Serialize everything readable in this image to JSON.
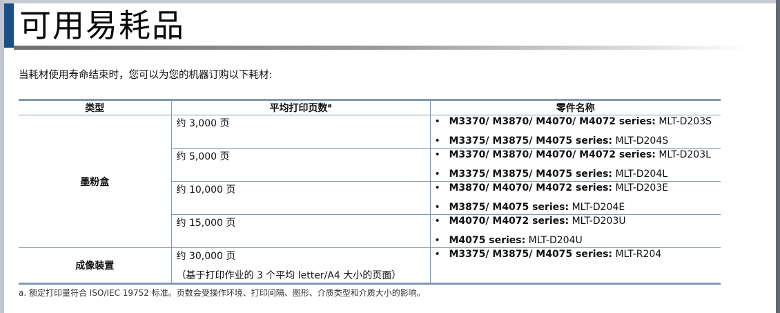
{
  "title": "可用易耗品",
  "intro": "当耗材使用寿命结束时，您可以为您的机器订购以下耗材:",
  "table": {
    "headers": {
      "type": "类型",
      "yield": "平均打印页数",
      "yield_sup": "a",
      "part": "零件名称"
    },
    "toner": {
      "type": "墨粉盒",
      "rows": [
        {
          "yield": "约 3,000 页",
          "parts": [
            {
              "models": "M3370/ M3870/ M4070/ M4072 series:",
              "code": " MLT-D203S"
            },
            {
              "models": "M3375/ M3875/ M4075 series:",
              "code": " MLT-D204S"
            }
          ]
        },
        {
          "yield": "约 5,000 页",
          "parts": [
            {
              "models": "M3370/ M3870/ M4070/ M4072 series:",
              "code": " MLT-D203L"
            },
            {
              "models": "M3375/ M3875/ M4075 series:",
              "code": " MLT-D204L"
            }
          ]
        },
        {
          "yield": "约 10,000 页",
          "parts": [
            {
              "models": "M3870/ M4070/ M4072 series:",
              "code": " MLT-D203E"
            },
            {
              "models": "M3875/ M4075 series:",
              "code": " MLT-D204E"
            }
          ]
        },
        {
          "yield": "约 15,000 页",
          "parts": [
            {
              "models": "M4070/ M4072 series:",
              "code": " MLT-D203U"
            },
            {
              "models": "M4075 series:",
              "code": " MLT-D204U"
            }
          ]
        }
      ]
    },
    "imaging": {
      "type": "成像装置",
      "yield": "约 30,000 页",
      "yield_note": "（基于打印作业的 3 个平均 letter/A4 大小的页面）",
      "parts": [
        {
          "models": "M3375/ M3875/ M4075 series:",
          "code": " MLT-R204"
        }
      ]
    },
    "bullet": "•"
  },
  "footnote": "a. 额定打印量符合 ISO/IEC 19752 标准。页数会受操作环境、打印间隔、图形、介质类型和介质大小的影响。"
}
